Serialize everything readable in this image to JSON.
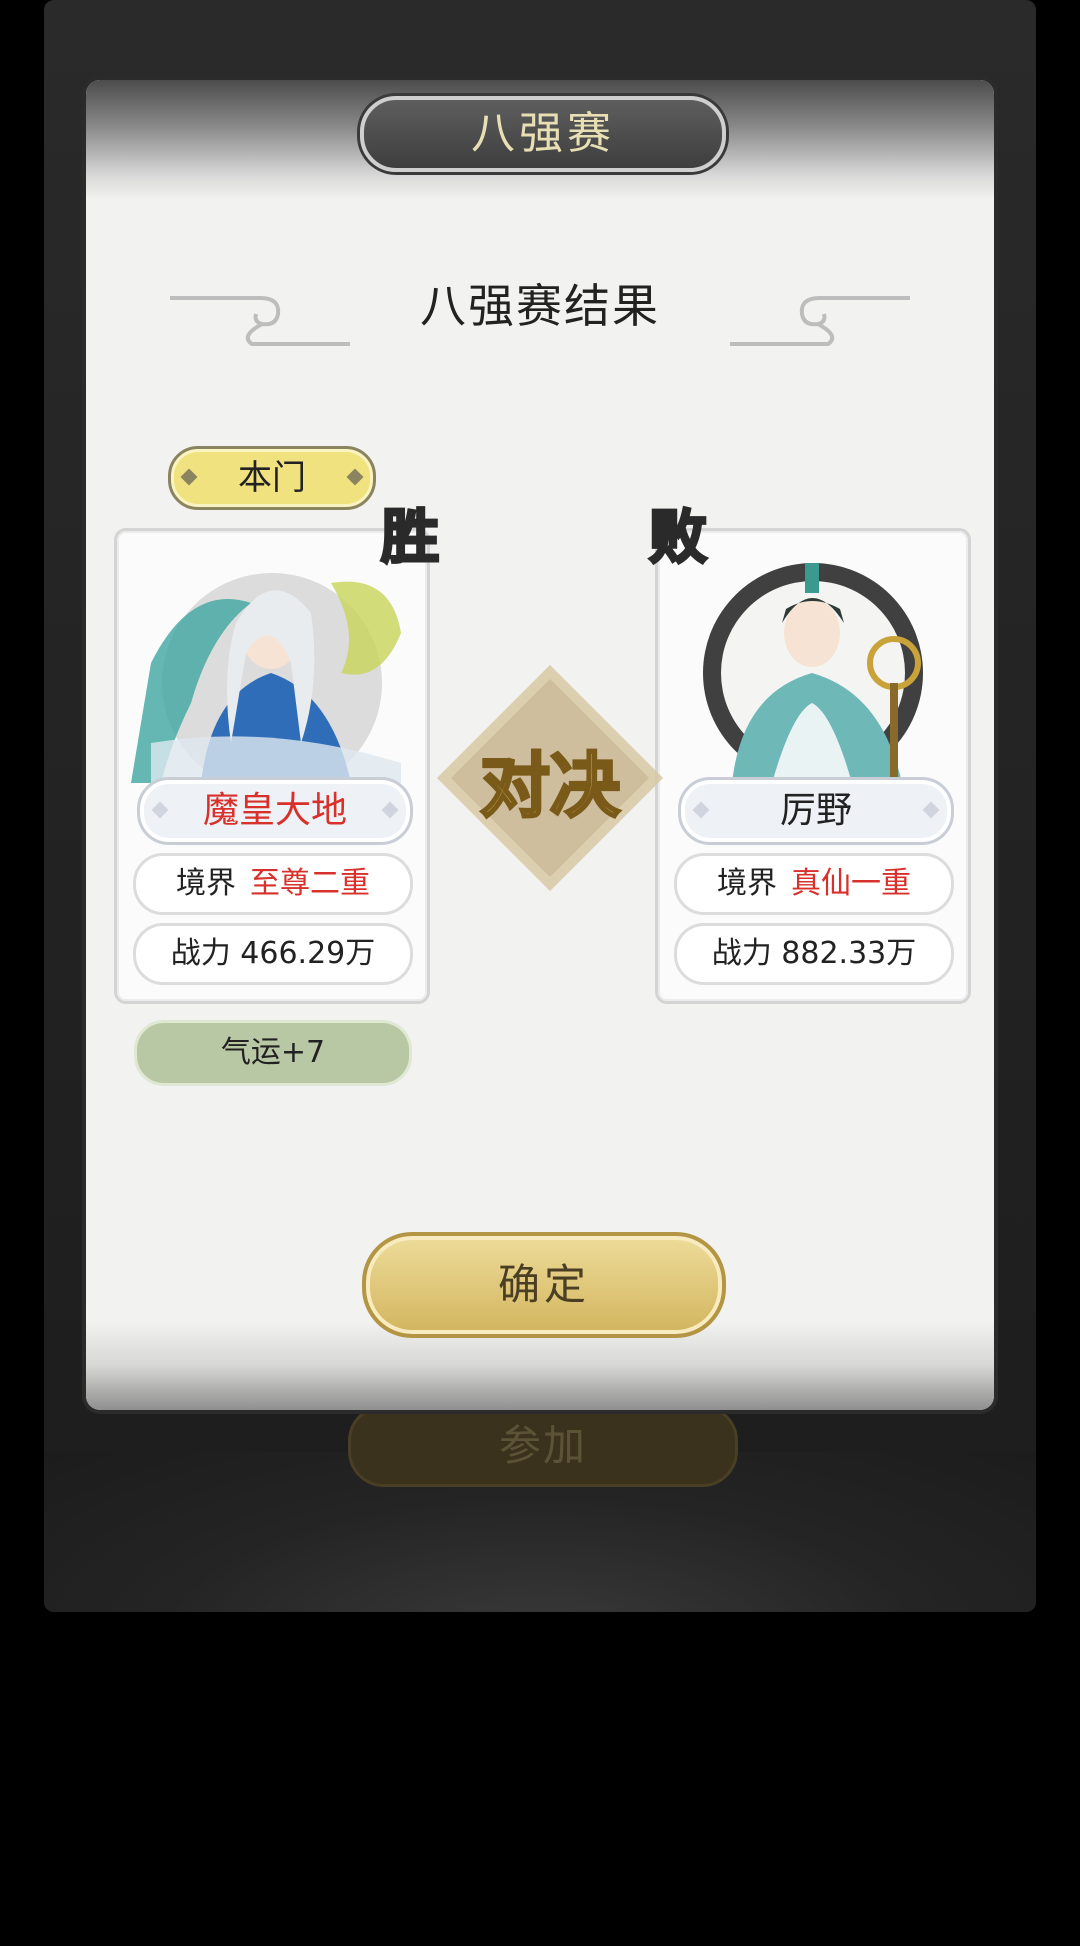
{
  "background": {
    "join_button_label": "参加"
  },
  "dialog": {
    "title": "八强赛",
    "result_title": "八强赛结果",
    "side_label": "本门",
    "vs_label": "对决",
    "confirm_label": "确定"
  },
  "left_player": {
    "result_badge": "胜",
    "name": "魔皇大地",
    "realm_label": "境界",
    "realm_value": "至尊二重",
    "power_text": "战力 466.29万",
    "fortune_text": "气运+7"
  },
  "right_player": {
    "result_badge": "败",
    "name": "厉野",
    "realm_label": "境界",
    "realm_value": "真仙一重",
    "power_text": "战力 882.33万"
  },
  "colors": {
    "win_badge": "#f2d062",
    "lose_badge": "#bcd3e4",
    "highlight_red": "#d8302a",
    "confirm_gold": "#d2b55e"
  }
}
